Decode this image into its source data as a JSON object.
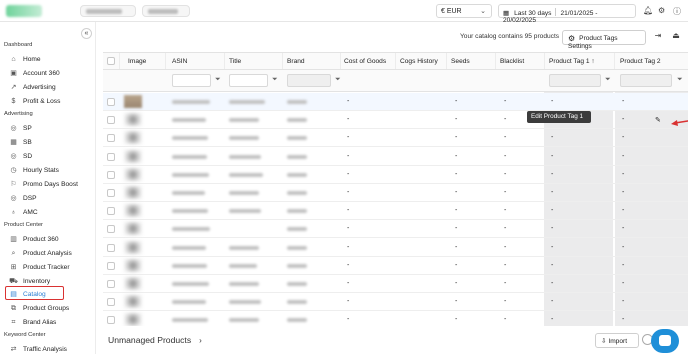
{
  "topbar": {
    "currency": "€ EUR",
    "date_label": "Last 30 days",
    "date_range": "21/01/2025 - 20/02/2025",
    "icons": [
      "calendar-icon",
      "bell-icon",
      "gear-icon",
      "help-icon"
    ]
  },
  "sidebar": {
    "sections": {
      "dashboard": "Dashboard",
      "advertising": "Advertising",
      "product_center": "Product Center",
      "keyword_center": "Keyword Center"
    },
    "items": [
      {
        "label": "Home",
        "icon": "home-icon"
      },
      {
        "label": "Account 360",
        "icon": "account-icon"
      },
      {
        "label": "Advertising",
        "icon": "trend-icon"
      },
      {
        "label": "Profit & Loss",
        "icon": "dollar-icon"
      },
      {
        "label": "SP",
        "icon": "target-icon"
      },
      {
        "label": "SB",
        "icon": "grid-icon"
      },
      {
        "label": "SD",
        "icon": "target-icon"
      },
      {
        "label": "Hourly Stats",
        "icon": "clock-icon"
      },
      {
        "label": "Promo Days Boost",
        "icon": "rocket-icon"
      },
      {
        "label": "DSP",
        "icon": "target-icon"
      },
      {
        "label": "AMC",
        "icon": "pin-icon"
      },
      {
        "label": "Product 360",
        "icon": "bars-icon"
      },
      {
        "label": "Product Analysis",
        "icon": "search-icon"
      },
      {
        "label": "Product Tracker",
        "icon": "tracker-icon"
      },
      {
        "label": "Inventory",
        "icon": "truck-icon"
      },
      {
        "label": "Catalog",
        "icon": "book-icon"
      },
      {
        "label": "Product Groups",
        "icon": "groups-icon"
      },
      {
        "label": "Brand Alias",
        "icon": "tag-icon"
      },
      {
        "label": "Traffic Analysis",
        "icon": "traffic-icon"
      }
    ]
  },
  "main": {
    "info_text": "Your catalog contains 95 products",
    "tags_button": "Product Tags Settings",
    "columns": [
      "Image",
      "ASIN",
      "Title",
      "Brand",
      "Cost of Goods",
      "Cogs History",
      "Seeds",
      "Blacklist",
      "Product Tag 1",
      "Product Tag 2"
    ],
    "sort_indicator": "↑",
    "dash": "-",
    "tooltip": "Edit Product Tag 1",
    "row_count": 13
  },
  "bottom": {
    "unmanaged": "Unmanaged Products",
    "import": "Import"
  },
  "colors": {
    "accent": "#2a7fd4",
    "highlight": "#d93232",
    "chat": "#1f8fd8"
  }
}
